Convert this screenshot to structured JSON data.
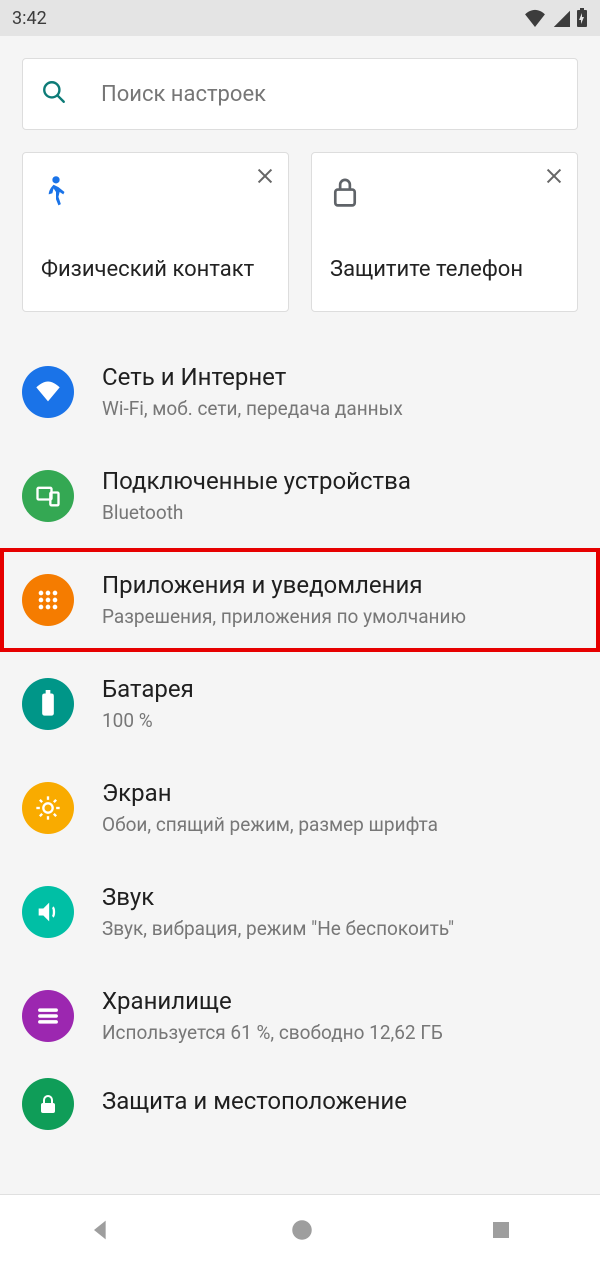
{
  "status": {
    "time": "3:42"
  },
  "search": {
    "placeholder": "Поиск настроек"
  },
  "cards": [
    {
      "title": "Физический контакт"
    },
    {
      "title": "Защитите телефон"
    }
  ],
  "items": [
    {
      "title": "Сеть и Интернет",
      "sub": "Wi-Fi, моб. сети, передача данных"
    },
    {
      "title": "Подключенные устройства",
      "sub": "Bluetooth"
    },
    {
      "title": "Приложения и уведомления",
      "sub": "Разрешения, приложения по умолчанию"
    },
    {
      "title": "Батарея",
      "sub": "100 %"
    },
    {
      "title": "Экран",
      "sub": "Обои, спящий режим, размер шрифта"
    },
    {
      "title": "Звук",
      "sub": "Звук, вибрация, режим \"Не беспокоить\""
    },
    {
      "title": "Хранилище",
      "sub": "Используется 61 %, свободно 12,62 ГБ"
    },
    {
      "title": "Защита и местоположение",
      "sub": ""
    }
  ]
}
